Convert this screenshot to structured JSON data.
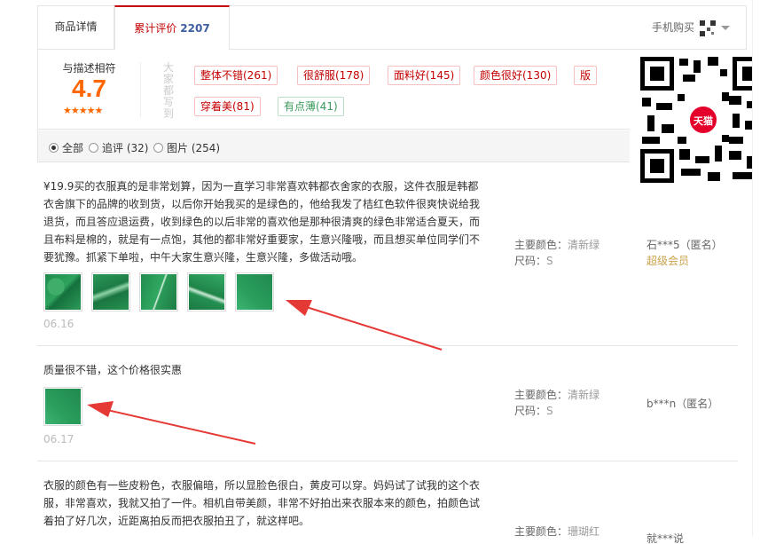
{
  "tabs": {
    "detail_label": "商品详情",
    "reviews_label": "累计评价",
    "reviews_count": "2207",
    "mobile_buy_label": "手机购买"
  },
  "summary": {
    "score_label": "与描述相符",
    "score_value": "4.7",
    "stars": "★★★★★",
    "impressions_label": "大家都写到",
    "tags": [
      {
        "label": "整体不错(261)",
        "tone": "positive"
      },
      {
        "label": "很舒服(178)",
        "tone": "positive"
      },
      {
        "label": "面料好(145)",
        "tone": "positive"
      },
      {
        "label": "颜色很好(130)",
        "tone": "positive"
      },
      {
        "label": "版",
        "tone": "positive"
      },
      {
        "label": "穿着美(81)",
        "tone": "positive"
      },
      {
        "label": "有点薄(41)",
        "tone": "negative"
      }
    ]
  },
  "qr": {
    "badge": "天猫"
  },
  "filters": {
    "all": "全部",
    "followup": "追评 (32)",
    "pictures": "图片 (254)",
    "selected": "all"
  },
  "reviews": [
    {
      "text": "¥19.9买的衣服真的是非常划算，因为一直学习非常喜欢韩都衣舍家的衣服，这件衣服是韩都衣舍旗下的品牌的收到货，以后你开始我买的是绿色的，他给我发了桔红色软件很爽快说给我退货，而且答应退运费，收到绿色的以后非常的喜欢他是那种很清爽的绿色非常适合夏天，而且布料是棉的，就是有一点饱，其他的都非常好重要家，生意兴隆哦，而且想买单位同学们不要犹豫。抓紧下单啦，中午大家生意兴隆，生意兴隆，多做活动哦。",
      "thumb_count": 5,
      "date": "06.16",
      "color_key": "主要颜色：",
      "color_value": "清新绿",
      "size_key": "尺码：",
      "size_value": "S",
      "user": "石***5（匿名）",
      "level": "超级会员"
    },
    {
      "text": "质量很不错，这个价格很实惠",
      "thumb_count": 1,
      "date": "06.17",
      "color_key": "主要颜色：",
      "color_value": "清新绿",
      "size_key": "尺码：",
      "size_value": "S",
      "user": "b***n（匿名）",
      "level": ""
    },
    {
      "text": "衣服的颜色有一些皮粉色，衣服偏暗，所以显脸色很白，黄皮可以穿。妈妈试了试我的这个衣服，非常喜欢，我就又拍了一件。相机自带美颜，非常不好拍出来衣服本来的颜色，拍颜色试着拍了好几次，近距离拍反而把衣服拍丑了，就这样吧。",
      "color_key": "主要颜色：",
      "color_value": "珊瑚红",
      "user": "就***说"
    }
  ],
  "annotations": {
    "arrow_color": "#e53935"
  }
}
